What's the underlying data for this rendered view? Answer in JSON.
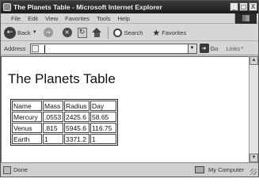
{
  "window": {
    "title": "The Planets Table - Microsoft Internet Explorer",
    "controls": {
      "minimize": "_",
      "maximize": "□",
      "close": "X"
    }
  },
  "menu": [
    "File",
    "Edit",
    "View",
    "Favorites",
    "Tools",
    "Help"
  ],
  "toolbar": {
    "back_label": "Back",
    "search_label": "Search",
    "favorites_label": "Favorites"
  },
  "address_bar": {
    "label": "Address",
    "value": "",
    "go_label": "Go",
    "links_label": "Links"
  },
  "page": {
    "heading": "The Planets Table",
    "table": {
      "headers": [
        "Name",
        "Mass",
        "Radius",
        "Day"
      ],
      "rows": [
        [
          "Mercury",
          ".0553",
          "2425.6",
          "58.65"
        ],
        [
          "Venus",
          ".815",
          "5945.6",
          "116.75"
        ],
        [
          "Earth",
          "1",
          "3371.2",
          "1"
        ]
      ]
    }
  },
  "status_bar": {
    "status": "Done",
    "zone": "My Computer"
  },
  "icons": {
    "back": "back-arrow-icon",
    "forward": "forward-arrow-icon",
    "stop": "stop-icon",
    "refresh": "refresh-icon",
    "home": "home-icon",
    "search": "search-icon",
    "favorites": "favorites-star-icon",
    "go": "go-arrow-icon"
  }
}
